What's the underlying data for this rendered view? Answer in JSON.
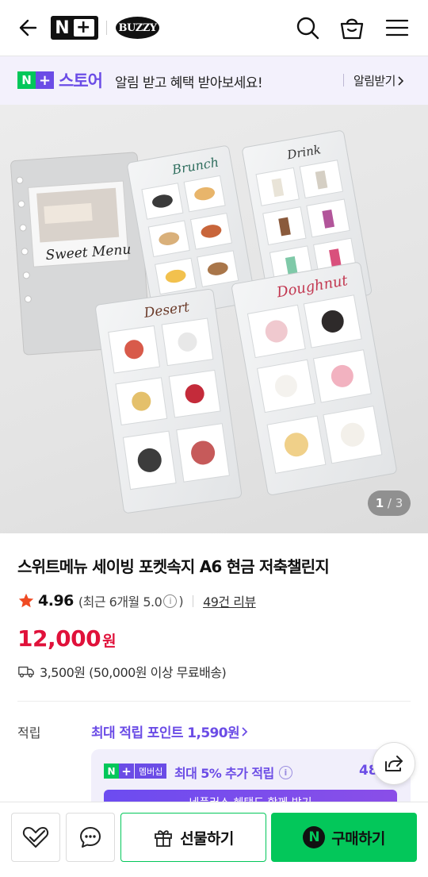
{
  "header": {
    "logo_np": "N",
    "logo_plus": "+",
    "logo_brand": "BUZZY"
  },
  "banner": {
    "store_n": "N",
    "store_plus": "+",
    "store_word": "스토어",
    "text": "알림 받고 혜택 받아보세요!",
    "link_label": "알림받기"
  },
  "gallery": {
    "current": "1",
    "separator": "/",
    "total": "3",
    "menu_card_titles": [
      "Sweet Menu",
      "Brunch",
      "Drink",
      "Desert",
      "Doughnut"
    ]
  },
  "product": {
    "title": "스위트메뉴 세이빙 포켓속지 A6 현금 저축챌린지",
    "rating": "4.96",
    "recent_rating": "(최근 6개월 5.0",
    "recent_close": ")",
    "review_count": "49건 리뷰",
    "price": "12,000",
    "price_unit": "원",
    "shipping": "3,500원 (50,000원 이상 무료배송)"
  },
  "points": {
    "label": "적립",
    "max_text": "최대 적립 포인트 1,590원",
    "membership_n": "N",
    "membership_plus": "+",
    "membership_badge": "멤버십",
    "membership_text": "최대 5% 추가 적립",
    "membership_value": "48",
    "membership_button": "네플러스 혜택도 함께 받기"
  },
  "bottom_bar": {
    "gift_label": "선물하기",
    "buy_label": "구매하기",
    "npay_letter": "N"
  },
  "colors": {
    "brand_green": "#03c75a",
    "brand_purple": "#6b4ce6",
    "price_red": "#e0113a"
  }
}
